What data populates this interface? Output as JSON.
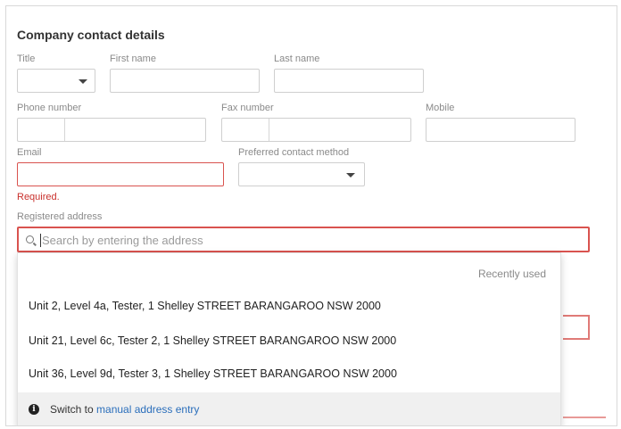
{
  "section": {
    "title": "Company contact details"
  },
  "fields": {
    "title": {
      "label": "Title",
      "value": ""
    },
    "first_name": {
      "label": "First name",
      "value": ""
    },
    "last_name": {
      "label": "Last name",
      "value": ""
    },
    "phone": {
      "label": "Phone number",
      "value": ""
    },
    "fax": {
      "label": "Fax number",
      "value": ""
    },
    "mobile": {
      "label": "Mobile",
      "value": ""
    },
    "email": {
      "label": "Email",
      "value": "",
      "error": "Required."
    },
    "preferred_contact": {
      "label": "Preferred contact method",
      "value": ""
    },
    "registered_address": {
      "label": "Registered address",
      "placeholder": "Search by entering the address"
    }
  },
  "suggestions": {
    "header": "Recently used",
    "items": [
      "Unit 2, Level 4a, Tester, 1 Shelley STREET BARANGAROO NSW 2000",
      "Unit 21, Level 6c, Tester 2, 1 Shelley STREET BARANGAROO NSW 2000",
      "Unit 36, Level 9d, Tester 3, 1 Shelley STREET BARANGAROO NSW 2000"
    ],
    "footer_prefix": "Switch to ",
    "footer_link": "manual address entry"
  },
  "colors": {
    "error": "#d9534f",
    "link": "#2a6ebb",
    "label": "#8a8a8a"
  },
  "icons": {
    "search": "search-icon",
    "info": "info-icon",
    "caret": "chevron-down-icon"
  }
}
